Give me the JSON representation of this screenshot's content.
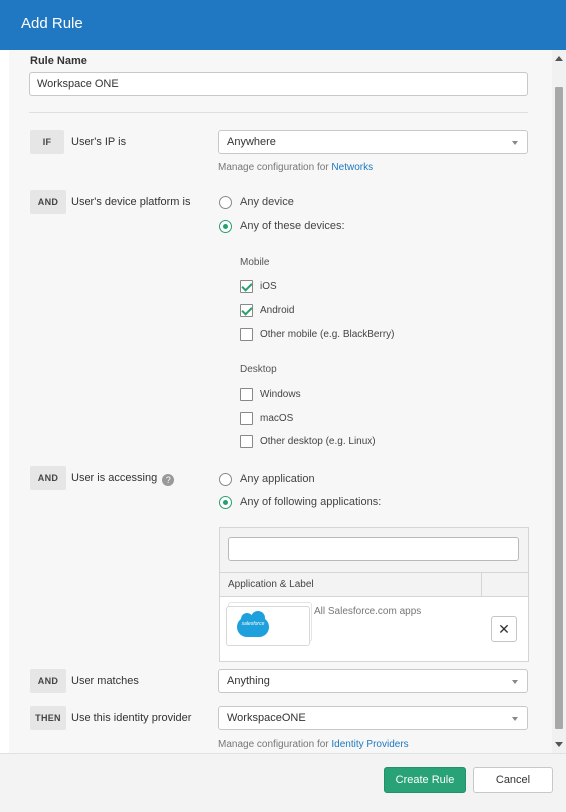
{
  "header": {
    "title": "Add Rule"
  },
  "rule_name": {
    "label": "Rule Name",
    "value": "Workspace ONE"
  },
  "conditions": {
    "ip": {
      "operator": "IF",
      "label": "User's IP is",
      "selected": "Anywhere",
      "helper_text": "Manage configuration for",
      "helper_link": "Networks"
    },
    "platform": {
      "operator": "AND",
      "label": "User's device platform is",
      "options": [
        {
          "label": "Any device",
          "checked": false
        },
        {
          "label": "Any of these devices:",
          "checked": true
        }
      ],
      "mobile": {
        "title": "Mobile",
        "items": [
          {
            "label": "iOS",
            "checked": true
          },
          {
            "label": "Android",
            "checked": true
          },
          {
            "label": "Other mobile (e.g. BlackBerry)",
            "checked": false
          }
        ]
      },
      "desktop": {
        "title": "Desktop",
        "items": [
          {
            "label": "Windows",
            "checked": false
          },
          {
            "label": "macOS",
            "checked": false
          },
          {
            "label": "Other desktop (e.g. Linux)",
            "checked": false
          }
        ]
      }
    },
    "accessing": {
      "operator": "AND",
      "label": "User is accessing",
      "help_icon": "?",
      "options": [
        {
          "label": "Any application",
          "checked": false
        },
        {
          "label": "Any of following applications:",
          "checked": true
        }
      ],
      "search_value": "",
      "table_header": "Application & Label",
      "apps": [
        {
          "logo_text": "salesforce",
          "name": "All Salesforce.com apps",
          "remove_label": "✕"
        }
      ]
    },
    "matches": {
      "operator": "AND",
      "label": "User matches",
      "selected": "Anything"
    },
    "identity_provider": {
      "operator": "THEN",
      "label": "Use this identity provider",
      "selected": "WorkspaceONE",
      "helper_text": "Manage configuration for",
      "helper_link": "Identity Providers"
    }
  },
  "footer": {
    "create_label": "Create Rule",
    "cancel_label": "Cancel"
  },
  "colors": {
    "header": "#1f78c1",
    "primary": "#2aa278",
    "accent_check": "#27a06c",
    "link": "#1f78c1"
  }
}
